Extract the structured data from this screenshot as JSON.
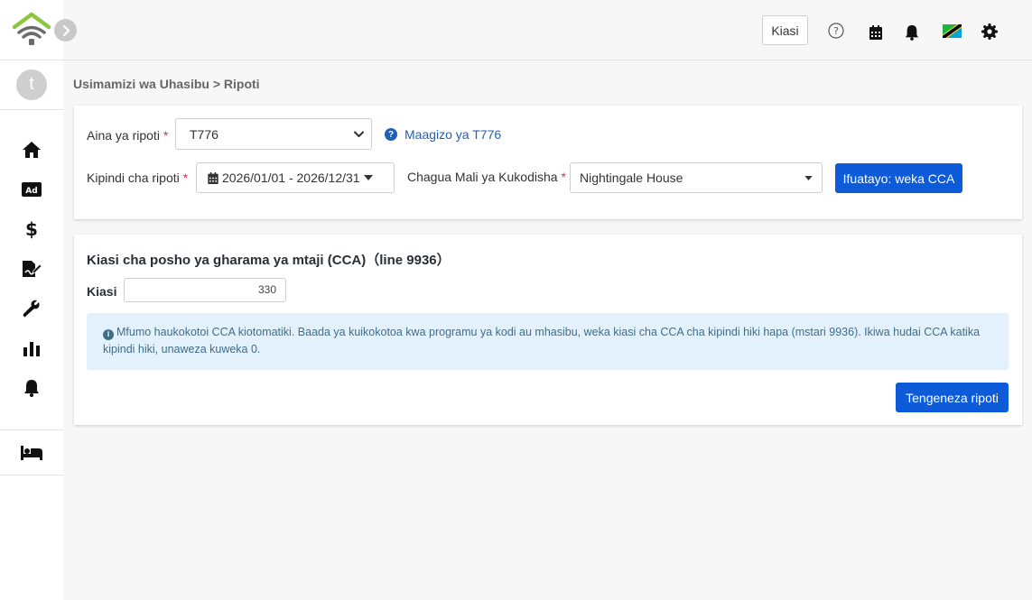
{
  "topbar": {
    "amount_button": "Kiasi"
  },
  "user": {
    "avatar_letter": "t"
  },
  "breadcrumb": "Usimamizi wa Uhasibu > Ripoti",
  "form": {
    "report_type_label": "Aina ya ripoti",
    "report_type_value": "T776",
    "guide_link": "Maagizo ya T776",
    "period_label": "Kipindi cha ripoti",
    "period_value": "2026/01/01 - 2026/12/31",
    "property_label": "Chagua Mali ya Kukodisha",
    "property_value": "Nightingale House",
    "next_button": "Ifuatayo: weka CCA",
    "required_mark": "*"
  },
  "cca": {
    "title": "Kiasi cha posho ya gharama ya mtaji (CCA)（line 9936）",
    "amount_label": "Kiasi",
    "amount_value": "330",
    "info_text": "Mfumo haukokotoi CCA kiotomatiki. Baada ya kuikokotoa kwa programu ya kodi au mhasibu, weka kiasi cha CCA cha kipindi hiki hapa (mstari 9936). Ikiwa hudai CCA katika kipindi hiki, unaweza kuweka 0.",
    "generate_button": "Tengeneza ripoti"
  },
  "colors": {
    "primary": "#0d5bd8",
    "link": "#1f5fb5",
    "logo_green": "#8cc63f",
    "info_bg": "#e3f1fc",
    "info_text": "#3f6e86"
  }
}
